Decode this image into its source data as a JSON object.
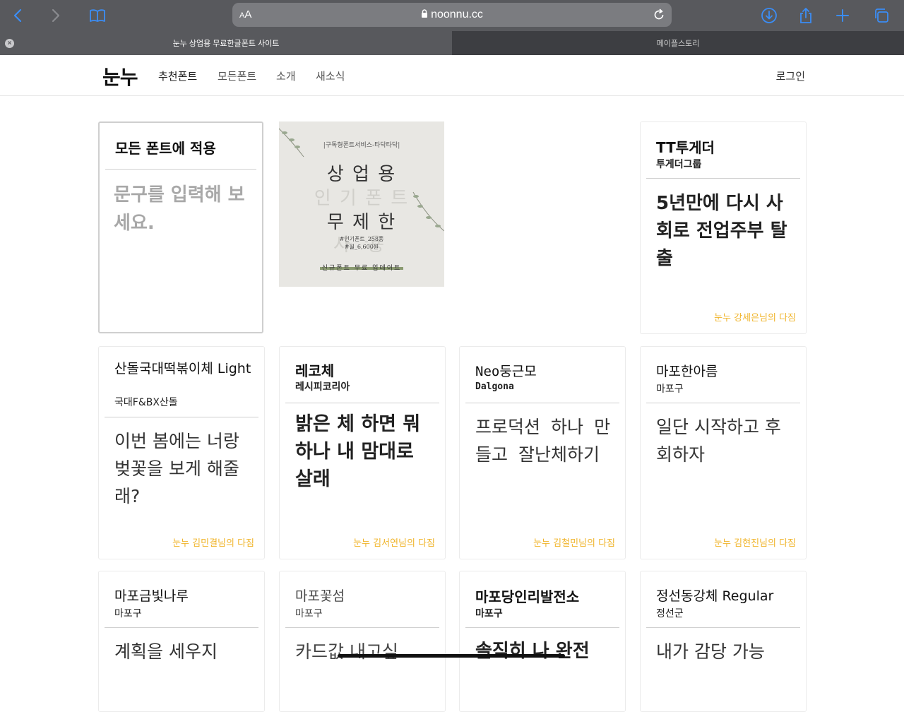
{
  "browser": {
    "aa_label": "AA",
    "url": "noonnu.cc",
    "tabs": [
      {
        "title": "눈누 상업용 무료한글폰트 사이트"
      },
      {
        "title": "메이플스토리"
      }
    ]
  },
  "site": {
    "logo": "눈누",
    "nav": [
      "추천폰트",
      "모든폰트",
      "소개",
      "새소식"
    ],
    "login": "로그인"
  },
  "apply_card": {
    "title": "모든 폰트에 적용",
    "placeholder": "문구를 입력해 보세요."
  },
  "ad": {
    "lines": [
      "|구독형폰트서비스-타닥타닥|",
      "상 업 용",
      "인 기 폰 트",
      "무 제 한",
      "사 용",
      "#인기폰트_258종",
      "#월_6,600원",
      "신규폰트 무료 업데이트"
    ]
  },
  "fonts": [
    {
      "name": "TT투게더",
      "maker": "투게더그룹",
      "sample": "5년만에 다시 사회로 전업주부 탈출",
      "pledge": "눈누 강세은님의 다짐"
    },
    {
      "name": "산돌국대떡볶이체 Light",
      "maker": "국대F&BX산돌",
      "sample": "이번 봄에는 너랑 벚꽃을 보게 해줄래?",
      "pledge": "눈누 김민결님의 다짐"
    },
    {
      "name": "레코체",
      "maker": "레시피코리아",
      "sample": "밝은 체 하면 뭐하나 내 맘대로 살래",
      "pledge": "눈누 김서연님의 다짐"
    },
    {
      "name": "Neo둥근모",
      "maker": "Dalgona",
      "sample": "프로덕션 하나 만들고 잘난체하기",
      "pledge": "눈누 김철민님의 다짐"
    },
    {
      "name": "마포한아름",
      "maker": "마포구",
      "sample": "일단 시작하고 후회하자",
      "pledge": "눈누 김현진님의 다짐"
    },
    {
      "name": "마포금빛나루",
      "maker": "마포구",
      "sample": "계획을 세우지"
    },
    {
      "name": "마포꽃섬",
      "maker": "마포구",
      "sample": "카드값 내고싶"
    },
    {
      "name": "마포당인리발전소",
      "maker": "마포구",
      "sample": "솔직히 나 완전"
    },
    {
      "name": "정선동강체 Regular",
      "maker": "정선군",
      "sample": "내가 감당 가능"
    }
  ]
}
